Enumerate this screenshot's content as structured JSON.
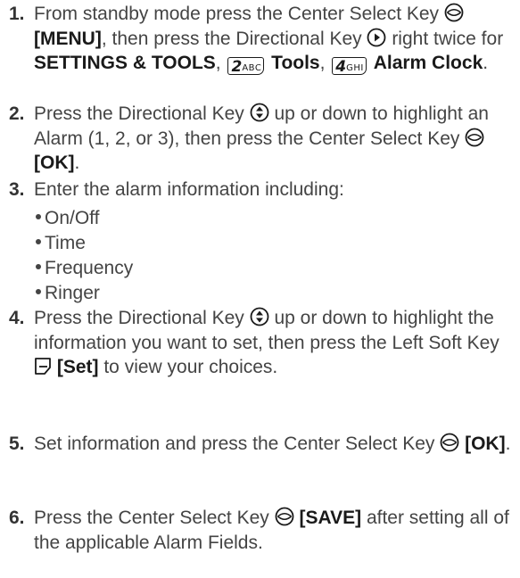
{
  "steps": [
    {
      "num": "1.",
      "t1": "From standby mode press the Center Select Key ",
      "b1": "[MENU]",
      "t2": ", then press the Directional Key ",
      "t3": " right twice for ",
      "b2": "SETTINGS & TOOLS",
      "t4": ", ",
      "key1_digit": "2",
      "key1_letters": "ABC",
      "b3": "Tools",
      "t5": ", ",
      "key2_digit": "4",
      "key2_letters": "GHI",
      "b4": "Alarm Clock",
      "t6": "."
    },
    {
      "num": "2.",
      "t1": "Press the Directional Key ",
      "t2": " up or down to highlight an Alarm (1, 2, or 3), then press the Center Select Key ",
      "b1": "[OK]",
      "t3": "."
    },
    {
      "num": "3.",
      "t1": "Enter the alarm information including:",
      "bullets": [
        "On/Off",
        "Time",
        "Frequency",
        "Ringer"
      ]
    },
    {
      "num": "4.",
      "t1": "Press the Directional Key ",
      "t2": " up or down to highlight the information you want to set, then press the Left Soft Key ",
      "b1": "[Set]",
      "t3": " to view your choices."
    },
    {
      "num": "5.",
      "t1": "Set information and press the Center Select Key ",
      "b1": "[OK]",
      "t2": "."
    },
    {
      "num": "6.",
      "t1": "Press the Center Select Key ",
      "b1": "[SAVE]",
      "t2": " after setting all of the applicable Alarm Fields."
    }
  ]
}
